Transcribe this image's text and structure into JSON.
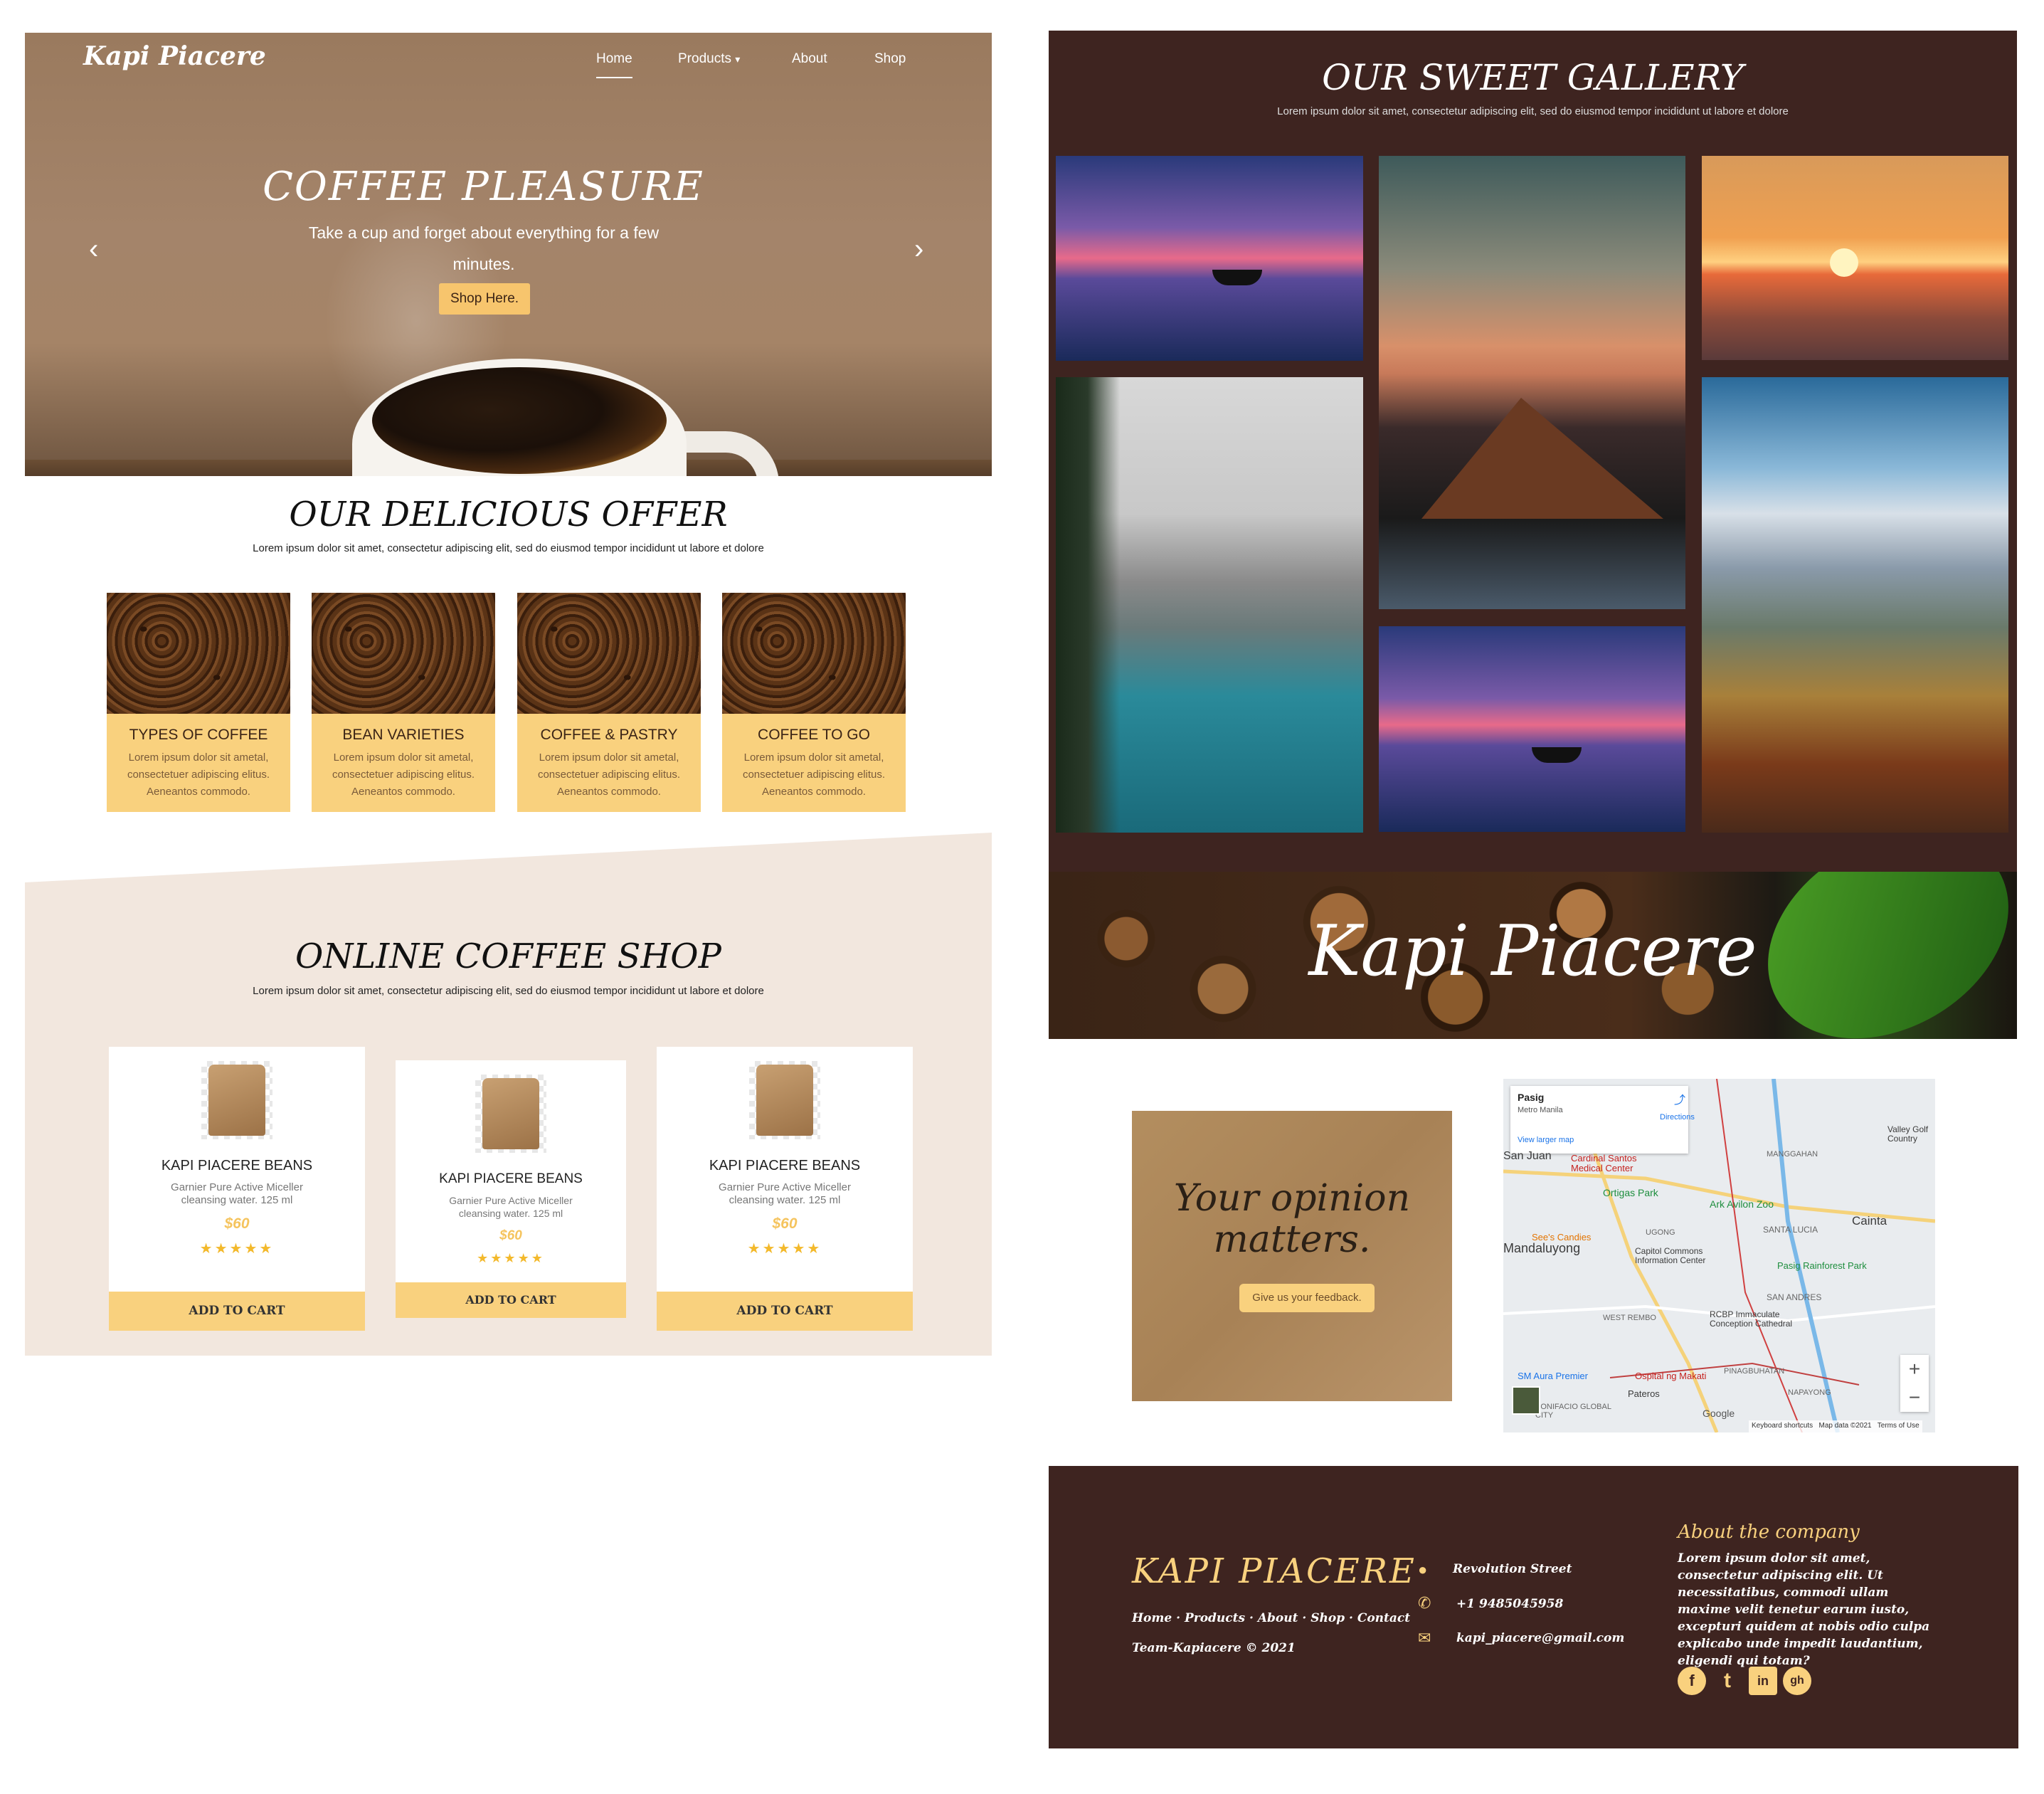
{
  "hero": {
    "brand": "Kapi Piacere",
    "nav": [
      "Home",
      "Products",
      "About",
      "Shop"
    ],
    "products_caret": "▾",
    "title": "COFFEE PLEASURE",
    "subtitle": "Take a cup and forget about everything for a few minutes.",
    "button": "Shop Here.",
    "prev": "‹",
    "next": "›"
  },
  "offer": {
    "title": "OUR DELICIOUS OFFER",
    "lorem": "Lorem ipsum dolor sit amet, consectetur adipiscing elit, sed do eiusmod tempor incididunt ut labore et dolore",
    "cards": [
      {
        "title": "TYPES OF COFFEE",
        "desc": "Lorem ipsum dolor sit ametal, consectetuer adipiscing elitus. Aeneantos commodo."
      },
      {
        "title": "BEAN VARIETIES",
        "desc": "Lorem ipsum dolor sit ametal, consectetuer adipiscing elitus. Aeneantos commodo."
      },
      {
        "title": "COFFEE & PASTRY",
        "desc": "Lorem ipsum dolor sit ametal, consectetuer adipiscing elitus. Aeneantos commodo."
      },
      {
        "title": "COFFEE TO GO",
        "desc": "Lorem ipsum dolor sit ametal, consectetuer adipiscing elitus. Aeneantos commodo."
      }
    ]
  },
  "shop": {
    "title": "ONLINE COFFEE SHOP",
    "lorem": "Lorem ipsum dolor sit amet, consectetur adipiscing elit, sed do eiusmod tempor incididunt ut labore et dolore",
    "products": [
      {
        "name": "KAPI PIACERE BEANS",
        "desc": "Garnier Pure Active Miceller cleansing water. 125 ml",
        "price": "$60",
        "stars": "★★★★★",
        "rating": 5,
        "cart": "ADD TO CART"
      },
      {
        "name": "KAPI PIACERE BEANS",
        "desc": "Garnier Pure Active Miceller cleansing water. 125 ml",
        "price": "$60",
        "stars": "★★★★★",
        "rating": 5,
        "cart": "ADD TO CART"
      },
      {
        "name": "KAPI PIACERE BEANS",
        "desc": "Garnier Pure Active Miceller cleansing water. 125 ml",
        "price": "$60",
        "stars": "★★★★★",
        "rating": 5,
        "cart": "ADD TO CART"
      }
    ]
  },
  "gallery": {
    "title": "OUR SWEET GALLERY",
    "lorem": "Lorem ipsum dolor sit amet, consectetur adipiscing elit, sed do eiusmod tempor incididunt ut labore et dolore"
  },
  "banner": {
    "text": "Kapi Piacere"
  },
  "feedback": {
    "title": "Your opinion matters.",
    "button": "Give us your feedback."
  },
  "map": {
    "place": "Pasig",
    "region": "Metro Manila",
    "larger": "View larger map",
    "directions": "Directions",
    "zoom_in": "+",
    "zoom_out": "−",
    "google": "Google",
    "shortcuts": "Keyboard shortcuts",
    "mapdata": "Map data ©2021",
    "terms": "Terms of Use",
    "labels": [
      "San Juan",
      "Cardinal Santos Medical Center",
      "Ortigas Park",
      "Ark Avilon Zoo",
      "Cainta",
      "SANTA LUCIA",
      "Mandaluyong",
      "Capitol Commons Information Center",
      "Pasig Rainforest Park",
      "See's Candies",
      "Valley Golf Country",
      "SAN ANDRES",
      "RCBP Immaculate Conception Cathedral",
      "SM Aura Premier",
      "Ospital ng Makati",
      "Pateros",
      "BONIFACIO GLOBAL CITY",
      "MANGGAHAN",
      "UGONG",
      "PINAGBUHATAN",
      "NAPAYONG",
      "WEST REMBO"
    ]
  },
  "footer": {
    "brand": "KAPI PIACERE",
    "links": "Home · Products · About · Shop · Contact",
    "copyright": "Team-Kapiacere © 2021",
    "address": "Revolution Street",
    "phone": "+1 9485045958",
    "email": "kapi_piacere@gmail.com",
    "about_title": "About the company",
    "about_text": "Lorem ipsum dolor sit amet, consectetur adipiscing elit. Ut necessitatibus, commodi ullam maxime velit tenetur earum iusto, excepturi quidem at nobis odio culpa explicabo unde impedit laudantium, eligendi qui totam?",
    "social": [
      "f",
      "t",
      "in",
      "gh"
    ]
  },
  "colors": {
    "accent": "#f9d17e",
    "dark": "#3e2420",
    "cream": "#f2e7de"
  }
}
